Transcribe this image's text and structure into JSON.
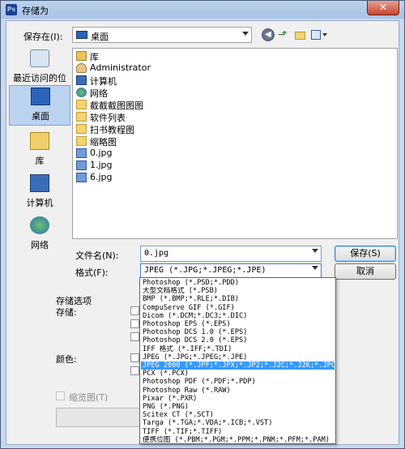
{
  "window": {
    "title": "存储为",
    "close_glyph": "✕"
  },
  "toolbar": {
    "save_in_label": "保存在(I):",
    "save_in_value": "桌面"
  },
  "places": [
    {
      "label": "最近访问的位置",
      "icon": "recent-places-icon"
    },
    {
      "label": "桌面",
      "icon": "desktop-icon",
      "selected": true
    },
    {
      "label": "库",
      "icon": "libraries-icon"
    },
    {
      "label": "计算机",
      "icon": "computer-icon"
    },
    {
      "label": "网络",
      "icon": "network-icon"
    }
  ],
  "files": [
    {
      "name": "库",
      "icon": "library-icon"
    },
    {
      "name": "Administrator",
      "icon": "user-folder-icon"
    },
    {
      "name": "计算机",
      "icon": "computer-icon"
    },
    {
      "name": "网络",
      "icon": "network-icon"
    },
    {
      "name": "截截截图图图",
      "icon": "folder-icon"
    },
    {
      "name": "软件列表",
      "icon": "folder-icon"
    },
    {
      "name": "扫书教程图",
      "icon": "folder-icon"
    },
    {
      "name": "缩略图",
      "icon": "folder-icon"
    },
    {
      "name": "0.jpg",
      "icon": "jpg-file-icon"
    },
    {
      "name": "1.jpg",
      "icon": "jpg-file-icon"
    },
    {
      "name": "6.jpg",
      "icon": "jpg-file-icon"
    }
  ],
  "form": {
    "filename_label": "文件名(N):",
    "filename_value": "0.jpg",
    "format_label": "格式(F):",
    "format_value": "JPEG (*.JPG;*.JPEG;*.JPE)",
    "save_button": "保存(S)",
    "cancel_button": "取消"
  },
  "options": {
    "group_title": "存储选项",
    "save_label": "存储:",
    "color_label": "颜色:",
    "thumbnail_label": "缩览图(T)"
  },
  "format_options": [
    "Photoshop (*.PSD;*.PDD)",
    "大型文档格式 (*.PSB)",
    "BMP (*.BMP;*.RLE;*.DIB)",
    "CompuServe GIF (*.GIF)",
    "Dicom (*.DCM;*.DC3;*.DIC)",
    "Photoshop EPS (*.EPS)",
    "Photoshop DCS 1.0 (*.EPS)",
    "Photoshop DCS 2.0 (*.EPS)",
    "IFF 格式 (*.IFF;*.TDI)",
    "JPEG (*.JPG;*.JPEG;*.JPE)",
    "JPEG 2000 (*.JPF;*.JPX;*.JP2;*.J2C;*.J2K;*.JPC)",
    "PCX (*.PCX)",
    "Photoshop PDF (*.PDF;*.PDP)",
    "Photoshop Raw (*.RAW)",
    "Pixar (*.PXR)",
    "PNG (*.PNG)",
    "Scitex CT (*.SCT)",
    "Targa (*.TGA;*.VDA;*.ICB;*.VST)",
    "TIFF (*.TIF;*.TIFF)",
    "便携位图 (*.PBM;*.PGM;*.PPM;*.PNM;*.PFM;*.PAM)"
  ],
  "highlighted_format_index": 10,
  "colors": {
    "highlight": "#3399ff",
    "title_bar": "#a9c2e4",
    "close_button": "#c7462f"
  }
}
